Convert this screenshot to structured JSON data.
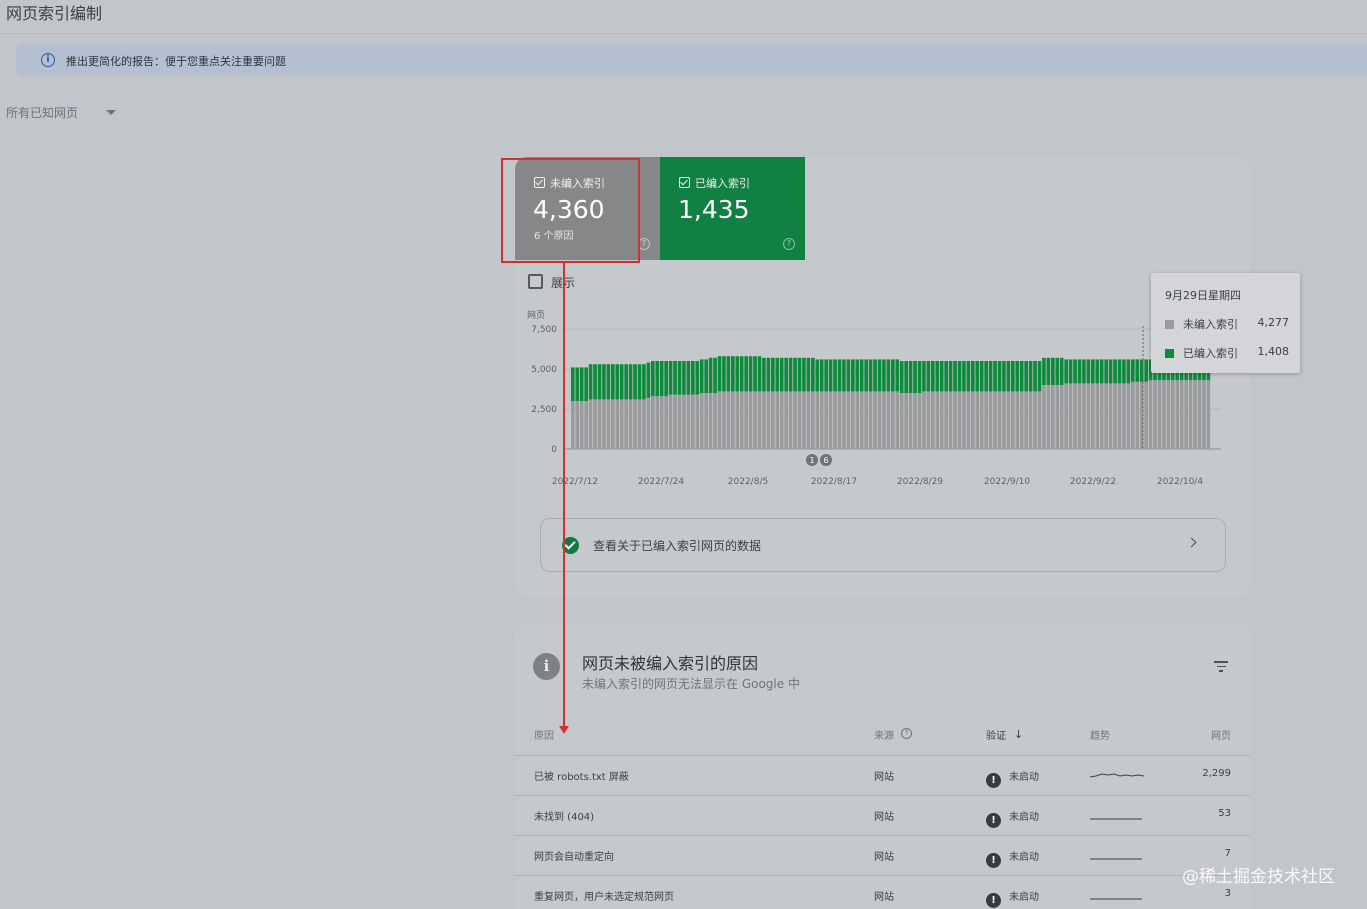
{
  "page": {
    "title": "网页索引编制",
    "banner": "推出更简化的报告：便于您重点关注重要问题",
    "filter": "所有已知网页"
  },
  "tiles": {
    "not_indexed": {
      "label": "未编入索引",
      "value": "4,360",
      "sub": "6 个原因"
    },
    "indexed": {
      "label": "已编入索引",
      "value": "1,435"
    }
  },
  "show_label": "展示",
  "colors": {
    "not_indexed": "#9a9b9d",
    "indexed": "#0f8a3d"
  },
  "chart_data": {
    "type": "bar",
    "stacked": true,
    "ylabel": "网页",
    "ylim": [
      0,
      7500
    ],
    "yticks": [
      0,
      2500,
      5000,
      7500
    ],
    "ytick_labels": [
      "0",
      "2,500",
      "5,000",
      "7,500"
    ],
    "xtick_labels": [
      "2022/7/12",
      "2022/7/24",
      "2022/8/5",
      "2022/8/17",
      "2022/8/29",
      "2022/9/10",
      "2022/9/22",
      "2022/10/4"
    ],
    "annotations": [
      "1",
      "6"
    ],
    "series": [
      {
        "name": "未编入索引",
        "values": [
          3000,
          3000,
          3000,
          3000,
          3100,
          3100,
          3100,
          3100,
          3100,
          3100,
          3100,
          3100,
          3100,
          3100,
          3100,
          3100,
          3100,
          3200,
          3300,
          3300,
          3300,
          3300,
          3400,
          3400,
          3400,
          3400,
          3400,
          3400,
          3400,
          3500,
          3500,
          3500,
          3500,
          3600,
          3600,
          3600,
          3600,
          3600,
          3600,
          3600,
          3600,
          3600,
          3600,
          3600,
          3600,
          3600,
          3600,
          3600,
          3600,
          3600,
          3600,
          3600,
          3600,
          3600,
          3600,
          3600,
          3600,
          3600,
          3600,
          3600,
          3600,
          3600,
          3600,
          3600,
          3600,
          3600,
          3600,
          3600,
          3600,
          3600,
          3600,
          3600,
          3600,
          3600,
          3500,
          3500,
          3500,
          3500,
          3500,
          3600,
          3600,
          3600,
          3600,
          3600,
          3600,
          3600,
          3600,
          3600,
          3600,
          3600,
          3600,
          3600,
          3600,
          3600,
          3600,
          3600,
          3600,
          3600,
          3600,
          3600,
          3600,
          3600,
          3600,
          3600,
          3600,
          3600,
          4000,
          4000,
          4000,
          4000,
          4000,
          4100,
          4100,
          4100,
          4100,
          4100,
          4100,
          4100,
          4100,
          4100,
          4100,
          4100,
          4100,
          4100,
          4100,
          4100,
          4200,
          4200,
          4200,
          4200,
          4300,
          4300,
          4300,
          4300,
          4300,
          4300,
          4300,
          4300,
          4300,
          4300,
          4300,
          4300,
          4300,
          4300
        ]
      },
      {
        "name": "已编入索引",
        "values": [
          2100,
          2100,
          2100,
          2100,
          2200,
          2200,
          2200,
          2200,
          2200,
          2200,
          2200,
          2200,
          2200,
          2200,
          2200,
          2200,
          2200,
          2200,
          2200,
          2200,
          2200,
          2200,
          2100,
          2100,
          2100,
          2100,
          2100,
          2100,
          2100,
          2100,
          2100,
          2200,
          2200,
          2200,
          2200,
          2200,
          2200,
          2200,
          2200,
          2200,
          2200,
          2200,
          2200,
          2100,
          2100,
          2100,
          2100,
          2100,
          2100,
          2100,
          2100,
          2100,
          2100,
          2100,
          2100,
          2000,
          2000,
          2000,
          2000,
          2000,
          2000,
          2000,
          2000,
          2000,
          2000,
          2000,
          2000,
          2000,
          2000,
          2000,
          2000,
          2000,
          2000,
          2000,
          2000,
          2000,
          2000,
          2000,
          2000,
          1900,
          1900,
          1900,
          1900,
          1900,
          1900,
          1900,
          1900,
          1900,
          1900,
          1900,
          1900,
          1900,
          1900,
          1900,
          1900,
          1900,
          1900,
          1900,
          1900,
          1900,
          1900,
          1900,
          1900,
          1900,
          1900,
          1900,
          1700,
          1700,
          1700,
          1700,
          1700,
          1500,
          1500,
          1500,
          1500,
          1500,
          1500,
          1500,
          1500,
          1500,
          1500,
          1500,
          1500,
          1500,
          1500,
          1500,
          1400,
          1400,
          1400,
          1400,
          1300,
          1300,
          1300,
          1300,
          1300,
          1300,
          1300,
          1300,
          1300,
          1300,
          1300,
          1300,
          1300,
          1300
        ]
      }
    ]
  },
  "tooltip": {
    "date": "9月29日星期四",
    "rows": [
      {
        "label": "未编入索引",
        "value": "4,277"
      },
      {
        "label": "已编入索引",
        "value": "1,408"
      }
    ]
  },
  "link_card": {
    "text": "查看关于已编入索引网页的数据"
  },
  "reasons": {
    "title": "网页未被编入索引的原因",
    "subtitle": "未编入索引的网页无法显示在 Google 中",
    "columns": {
      "reason": "原因",
      "source": "来源",
      "validation": "验证",
      "trend": "趋势",
      "pages": "网页"
    },
    "rows": [
      {
        "reason": "已被 robots.txt 屏蔽",
        "source": "网站",
        "validation": "未启动",
        "pages": "2,299"
      },
      {
        "reason": "未找到 (404)",
        "source": "网站",
        "validation": "未启动",
        "pages": "53"
      },
      {
        "reason": "网页会自动重定向",
        "source": "网站",
        "validation": "未启动",
        "pages": "7"
      },
      {
        "reason": "重复网页，用户未选定规范网页",
        "source": "网站",
        "validation": "未启动",
        "pages": "3"
      }
    ]
  },
  "watermark": "@稀土掘金技术社区"
}
